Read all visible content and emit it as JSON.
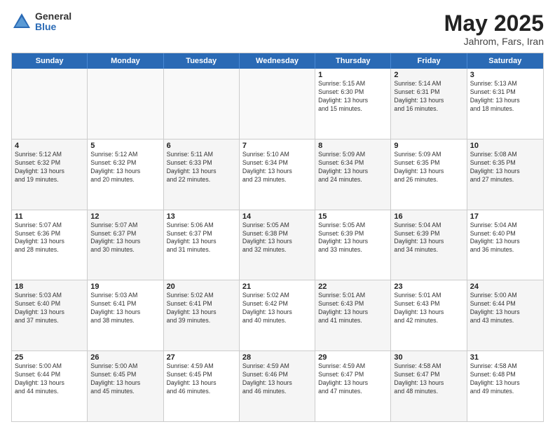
{
  "logo": {
    "general": "General",
    "blue": "Blue"
  },
  "title": {
    "month": "May 2025",
    "location": "Jahrom, Fars, Iran"
  },
  "weekdays": [
    "Sunday",
    "Monday",
    "Tuesday",
    "Wednesday",
    "Thursday",
    "Friday",
    "Saturday"
  ],
  "rows": [
    [
      {
        "day": "",
        "text": "",
        "alt": false,
        "empty": true
      },
      {
        "day": "",
        "text": "",
        "alt": false,
        "empty": true
      },
      {
        "day": "",
        "text": "",
        "alt": false,
        "empty": true
      },
      {
        "day": "",
        "text": "",
        "alt": false,
        "empty": true
      },
      {
        "day": "1",
        "text": "Sunrise: 5:15 AM\nSunset: 6:30 PM\nDaylight: 13 hours\nand 15 minutes.",
        "alt": false
      },
      {
        "day": "2",
        "text": "Sunrise: 5:14 AM\nSunset: 6:31 PM\nDaylight: 13 hours\nand 16 minutes.",
        "alt": true
      },
      {
        "day": "3",
        "text": "Sunrise: 5:13 AM\nSunset: 6:31 PM\nDaylight: 13 hours\nand 18 minutes.",
        "alt": false
      }
    ],
    [
      {
        "day": "4",
        "text": "Sunrise: 5:12 AM\nSunset: 6:32 PM\nDaylight: 13 hours\nand 19 minutes.",
        "alt": true
      },
      {
        "day": "5",
        "text": "Sunrise: 5:12 AM\nSunset: 6:32 PM\nDaylight: 13 hours\nand 20 minutes.",
        "alt": false
      },
      {
        "day": "6",
        "text": "Sunrise: 5:11 AM\nSunset: 6:33 PM\nDaylight: 13 hours\nand 22 minutes.",
        "alt": true
      },
      {
        "day": "7",
        "text": "Sunrise: 5:10 AM\nSunset: 6:34 PM\nDaylight: 13 hours\nand 23 minutes.",
        "alt": false
      },
      {
        "day": "8",
        "text": "Sunrise: 5:09 AM\nSunset: 6:34 PM\nDaylight: 13 hours\nand 24 minutes.",
        "alt": true
      },
      {
        "day": "9",
        "text": "Sunrise: 5:09 AM\nSunset: 6:35 PM\nDaylight: 13 hours\nand 26 minutes.",
        "alt": false
      },
      {
        "day": "10",
        "text": "Sunrise: 5:08 AM\nSunset: 6:35 PM\nDaylight: 13 hours\nand 27 minutes.",
        "alt": true
      }
    ],
    [
      {
        "day": "11",
        "text": "Sunrise: 5:07 AM\nSunset: 6:36 PM\nDaylight: 13 hours\nand 28 minutes.",
        "alt": false
      },
      {
        "day": "12",
        "text": "Sunrise: 5:07 AM\nSunset: 6:37 PM\nDaylight: 13 hours\nand 30 minutes.",
        "alt": true
      },
      {
        "day": "13",
        "text": "Sunrise: 5:06 AM\nSunset: 6:37 PM\nDaylight: 13 hours\nand 31 minutes.",
        "alt": false
      },
      {
        "day": "14",
        "text": "Sunrise: 5:05 AM\nSunset: 6:38 PM\nDaylight: 13 hours\nand 32 minutes.",
        "alt": true
      },
      {
        "day": "15",
        "text": "Sunrise: 5:05 AM\nSunset: 6:39 PM\nDaylight: 13 hours\nand 33 minutes.",
        "alt": false
      },
      {
        "day": "16",
        "text": "Sunrise: 5:04 AM\nSunset: 6:39 PM\nDaylight: 13 hours\nand 34 minutes.",
        "alt": true
      },
      {
        "day": "17",
        "text": "Sunrise: 5:04 AM\nSunset: 6:40 PM\nDaylight: 13 hours\nand 36 minutes.",
        "alt": false
      }
    ],
    [
      {
        "day": "18",
        "text": "Sunrise: 5:03 AM\nSunset: 6:40 PM\nDaylight: 13 hours\nand 37 minutes.",
        "alt": true
      },
      {
        "day": "19",
        "text": "Sunrise: 5:03 AM\nSunset: 6:41 PM\nDaylight: 13 hours\nand 38 minutes.",
        "alt": false
      },
      {
        "day": "20",
        "text": "Sunrise: 5:02 AM\nSunset: 6:41 PM\nDaylight: 13 hours\nand 39 minutes.",
        "alt": true
      },
      {
        "day": "21",
        "text": "Sunrise: 5:02 AM\nSunset: 6:42 PM\nDaylight: 13 hours\nand 40 minutes.",
        "alt": false
      },
      {
        "day": "22",
        "text": "Sunrise: 5:01 AM\nSunset: 6:43 PM\nDaylight: 13 hours\nand 41 minutes.",
        "alt": true
      },
      {
        "day": "23",
        "text": "Sunrise: 5:01 AM\nSunset: 6:43 PM\nDaylight: 13 hours\nand 42 minutes.",
        "alt": false
      },
      {
        "day": "24",
        "text": "Sunrise: 5:00 AM\nSunset: 6:44 PM\nDaylight: 13 hours\nand 43 minutes.",
        "alt": true
      }
    ],
    [
      {
        "day": "25",
        "text": "Sunrise: 5:00 AM\nSunset: 6:44 PM\nDaylight: 13 hours\nand 44 minutes.",
        "alt": false
      },
      {
        "day": "26",
        "text": "Sunrise: 5:00 AM\nSunset: 6:45 PM\nDaylight: 13 hours\nand 45 minutes.",
        "alt": true
      },
      {
        "day": "27",
        "text": "Sunrise: 4:59 AM\nSunset: 6:45 PM\nDaylight: 13 hours\nand 46 minutes.",
        "alt": false
      },
      {
        "day": "28",
        "text": "Sunrise: 4:59 AM\nSunset: 6:46 PM\nDaylight: 13 hours\nand 46 minutes.",
        "alt": true
      },
      {
        "day": "29",
        "text": "Sunrise: 4:59 AM\nSunset: 6:47 PM\nDaylight: 13 hours\nand 47 minutes.",
        "alt": false
      },
      {
        "day": "30",
        "text": "Sunrise: 4:58 AM\nSunset: 6:47 PM\nDaylight: 13 hours\nand 48 minutes.",
        "alt": true
      },
      {
        "day": "31",
        "text": "Sunrise: 4:58 AM\nSunset: 6:48 PM\nDaylight: 13 hours\nand 49 minutes.",
        "alt": false
      }
    ]
  ]
}
